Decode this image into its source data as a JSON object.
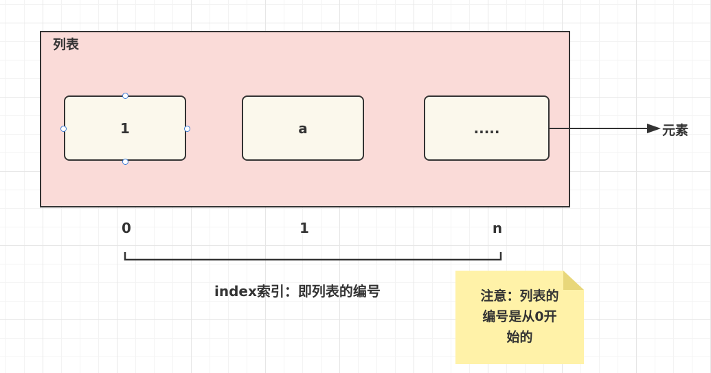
{
  "list": {
    "title": "列表",
    "cells": [
      "1",
      "a",
      "....."
    ],
    "indices": [
      "0",
      "1",
      "n"
    ]
  },
  "element_label": "元素",
  "index_caption": "index索引：即列表的编号",
  "note": {
    "text": "注意：列表的\n编号是从0开\n始的"
  },
  "colors": {
    "container_fill": "#fadbd8",
    "cell_fill": "#fbf8ec",
    "note_fill": "#fff2a8",
    "stroke": "#333333",
    "handle": "#3a7bd5"
  }
}
